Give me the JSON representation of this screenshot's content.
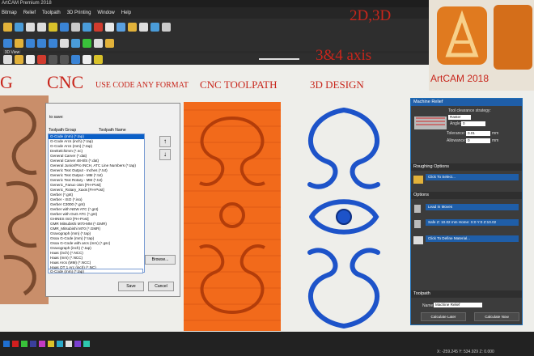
{
  "window": {
    "title": "ArtCAM Premium 2018"
  },
  "menu": [
    "Bitmap",
    "Relief",
    "Toolpath",
    "3D Printing",
    "Window",
    "Help"
  ],
  "view_tab": "3D View",
  "headlines": {
    "line1": "2D,3D",
    "line2": "3&4 axis",
    "left_letter": "G",
    "cnc": "CNC",
    "use_code": "USE CODE ANY FORMAT",
    "cnc_toolpath": "CNC TOOLPATH",
    "design_3d": "3D DESIGN"
  },
  "badge": {
    "label": "ArtCAM 2018"
  },
  "dialog": {
    "save_prompt": "to save:",
    "col_group": "Toolpath Group",
    "col_name": "Toolpath Name",
    "formats": [
      "G-Code (mm) (*.tap)",
      "G-Code Arcs (inch) (*.tap)",
      "G-Code Arcs (mm) (*.tap)",
      "Deekelchimm (*.nc)",
      "General Carver (*.dat)",
      "General Carver 48-8/S (*.dat)",
      "General Junior/Pro INCH, ATC Line Numbers (*.tap)",
      "Generic Text Output - Inches (*.txt)",
      "Generic Text Output - MM (*.txt)",
      "Generic Text Rotary - MM (*.txt)",
      "Generic_Fanuc-15m [FH-Post]",
      "Generic_Rotary_Xaxis [FH-Post]",
      "Gerber (*.gnt)",
      "Gerber - ISO (*.iso)",
      "Gerber C3000 (*.gnt)",
      "Gerber with NEW ATC (*.gnt)",
      "Gerber with OLD ATC (*.gnt)",
      "GHINES ISO [FH-Post]",
      "GMR Mitsubishi M70-MM (*.GMR)",
      "GMR_Mitsubishi M70 (*.GMR)",
      "Gravograph (mm) (*.tap)",
      "Gsoa G-Code (mm) (*.tap)",
      "Gsoa G-Code with arcs (mm) (*.gsc)",
      "Gravograph (inch) (*.tap)",
      "Haas (inch) (*.NCC)",
      "Haas (mm) (*.NCC)",
      "Haas Arcs (MM) (*.NCC)",
      "Haas OT 1 Arc (inch) (*.NC)",
      "Haas OM2 (INCH) (*.NC)",
      "Haas OM2 (MM) (*.NC)",
      "Haas Rotary (inch) (*.NCC)",
      "Haas Rotary (mm) (*.tap)"
    ],
    "selected_format": "G-Code (mm) (*.tap)",
    "browse": "Browse...",
    "save": "Save",
    "cancel": "Cancel"
  },
  "panel": {
    "title": "Machine Relief",
    "clearance_label": "Tool clearance strategy:",
    "clearance_value": "Raster",
    "angle_label": "Angle:",
    "angle_value": "0",
    "tolerance_label": "Tolerance:",
    "tolerance_value": "0.01",
    "tolerance_unit": "mm",
    "allowance_label": "Allowance:",
    "allowance_value": "0",
    "allowance_unit": "mm",
    "roughing_title": "Roughing Options",
    "click_select": "Click To Select...",
    "options_title": "Options",
    "lead_in": "Lead In Moves",
    "safe_z": "Safe Z: 10.02 mm  Home: X:0 Y:0 Z:10.02",
    "material": "Click To Define Material...",
    "toolpath_title": "Toolpath",
    "name_label": "Name:",
    "name_value": "Machine Relief",
    "calc_later": "Calculate Later",
    "calc_now": "Calculate Now"
  },
  "status": {
    "coords": "X: -259.245    Y: 534.929    Z: 0.000"
  },
  "palette": [
    "#1f6fd1",
    "#d11f1f",
    "#39c23a",
    "#3a3f9c",
    "#c33bc3",
    "#d9c22a",
    "#2aa9c9",
    "#e0e0e0",
    "#7a3fd1",
    "#2ec7b0"
  ],
  "colors": {
    "accent_blue": "#1f5ea8",
    "overlay_red": "#c8261c",
    "toolpath_orange": "#f26a1b",
    "design_blue": "#1d53c9"
  }
}
